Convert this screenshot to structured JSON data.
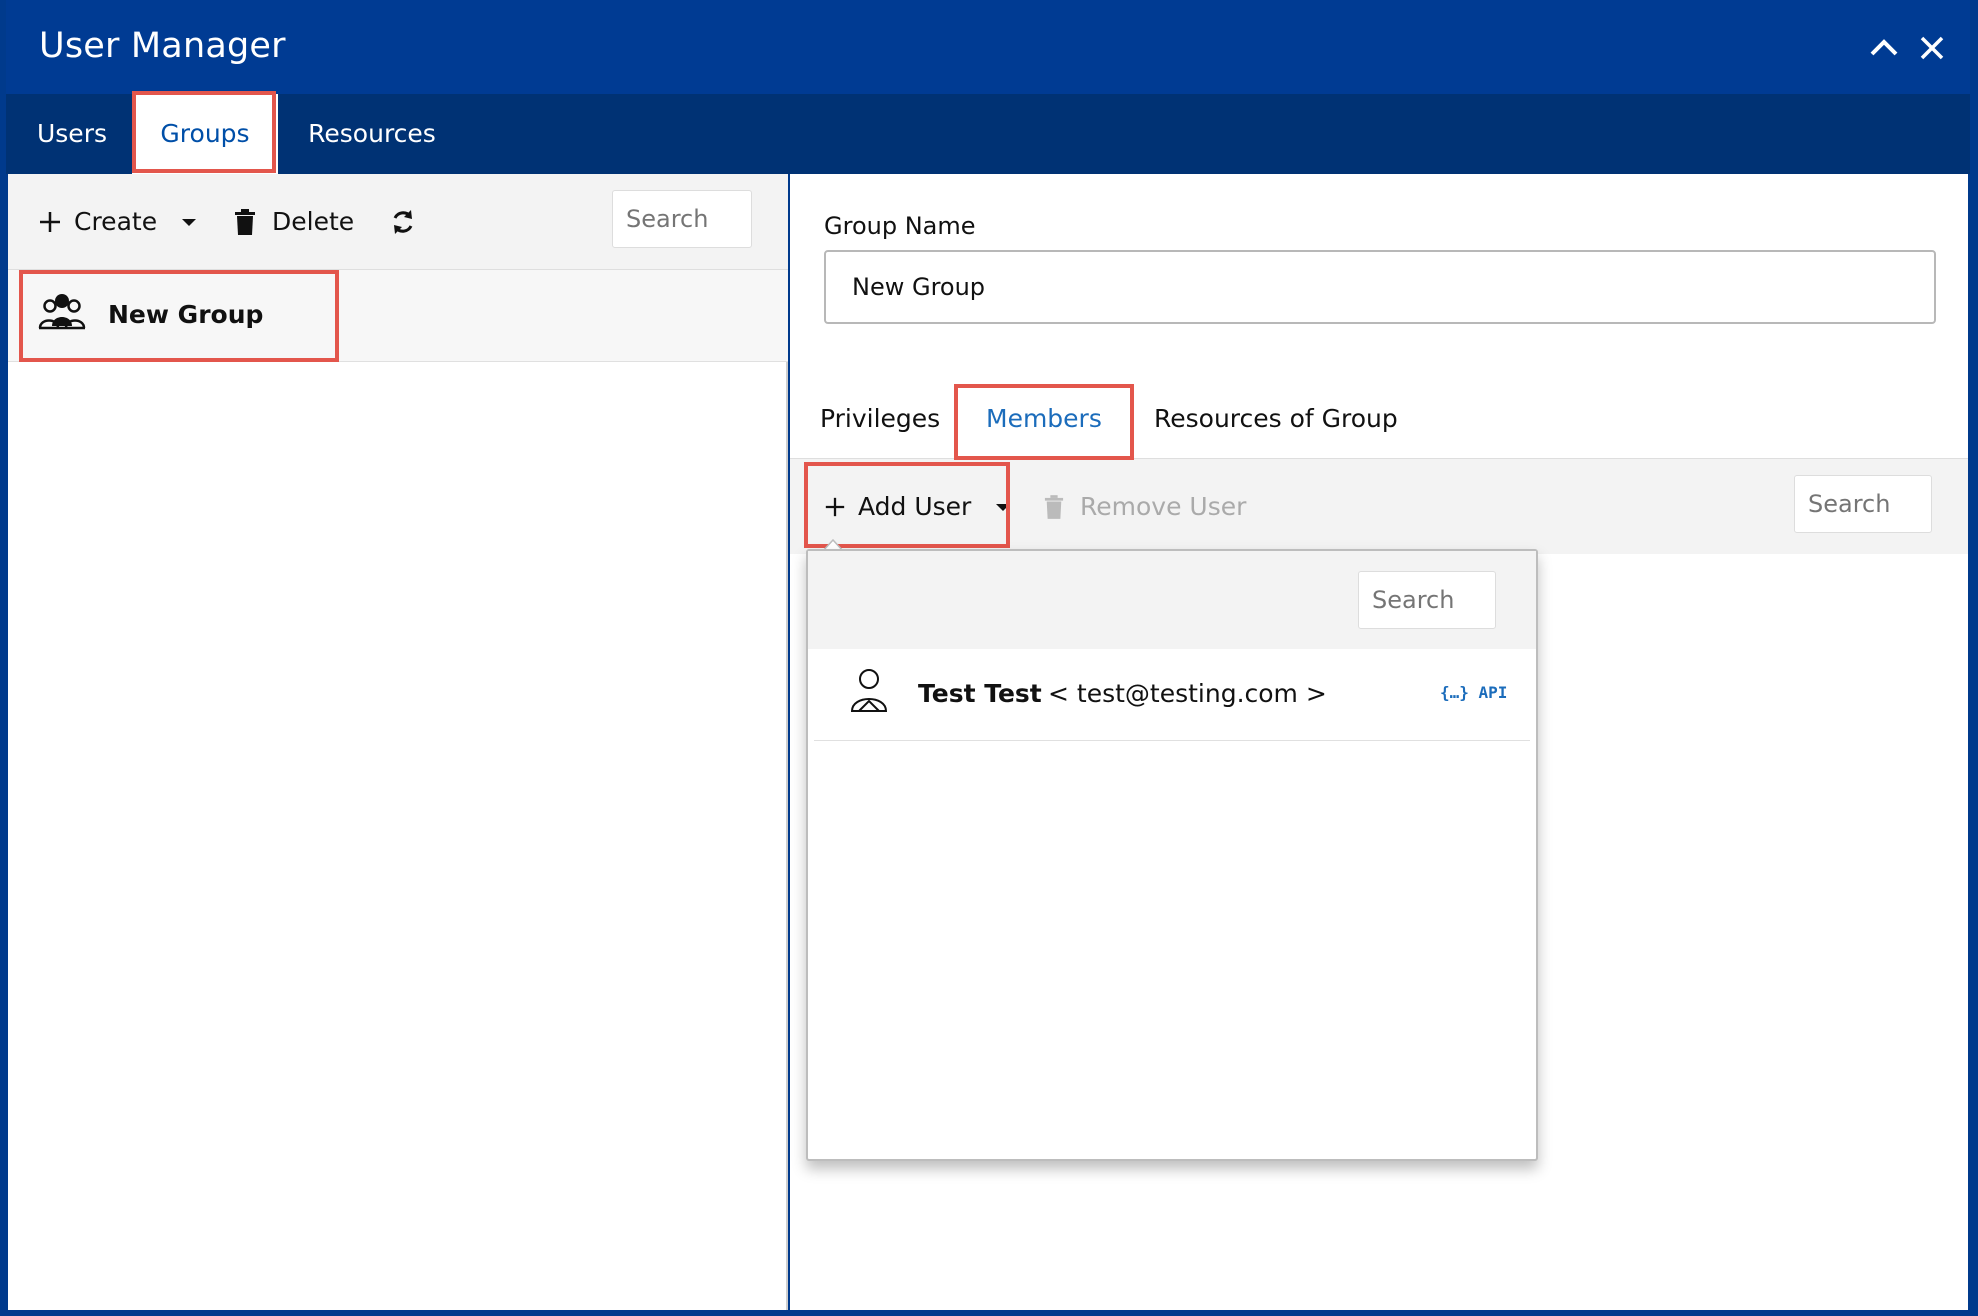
{
  "window": {
    "title": "User Manager"
  },
  "main_tabs": [
    {
      "label": "Users",
      "active": false
    },
    {
      "label": "Groups",
      "active": true
    },
    {
      "label": "Resources",
      "active": false
    }
  ],
  "left_toolbar": {
    "create_label": "Create",
    "delete_label": "Delete",
    "search_placeholder": "Search"
  },
  "groups": [
    {
      "name": "New Group",
      "selected": true
    }
  ],
  "group_form": {
    "name_label": "Group Name",
    "name_value": "New Group"
  },
  "sub_tabs": [
    {
      "label": "Privileges",
      "active": false
    },
    {
      "label": "Members",
      "active": true
    },
    {
      "label": "Resources of Group",
      "active": false
    }
  ],
  "members_toolbar": {
    "add_user_label": "Add User",
    "remove_user_label": "Remove User",
    "search_placeholder": "Search"
  },
  "add_user_dropdown": {
    "search_placeholder": "Search",
    "users": [
      {
        "name": "Test Test",
        "email": "< test@testing.com >",
        "badge": "{…} API"
      }
    ]
  },
  "colors": {
    "titlebar": "#003b93",
    "tabbar": "#003274",
    "accent": "#1b6cbb",
    "highlight": "#e3564c"
  }
}
